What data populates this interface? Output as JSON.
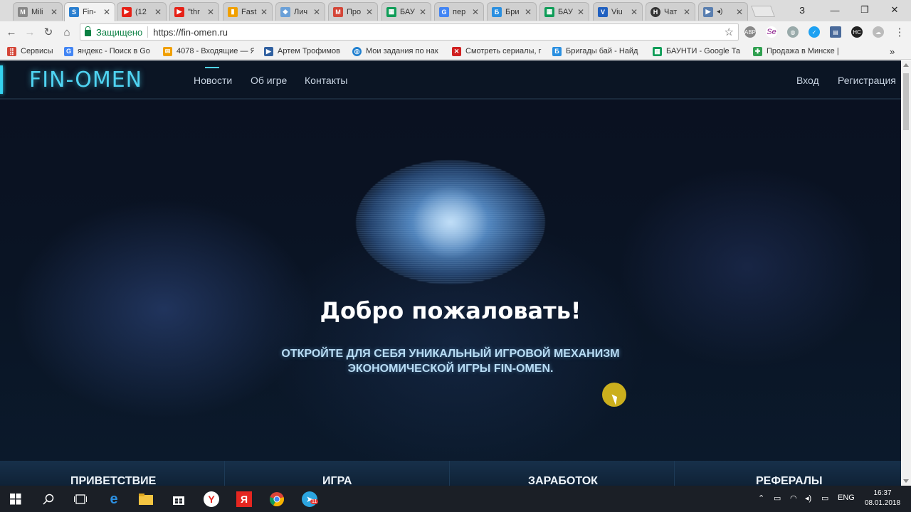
{
  "browser": {
    "tabs": [
      {
        "title": "Mili",
        "favicon": "gmail-m",
        "color": "#888888"
      },
      {
        "title": "Fin-",
        "favicon": "fin-omen",
        "color": "#2a7fd0",
        "active": true
      },
      {
        "title": "(12",
        "favicon": "youtube",
        "color": "#e62117"
      },
      {
        "title": "\"thr",
        "favicon": "youtube",
        "color": "#e62117"
      },
      {
        "title": "Fast",
        "favicon": "chart",
        "color": "#f0a000"
      },
      {
        "title": "Лич",
        "favicon": "diamond",
        "color": "#6aa0d8"
      },
      {
        "title": "Про",
        "favicon": "gmail",
        "color": "#d44638"
      },
      {
        "title": "БАУ",
        "favicon": "sheets",
        "color": "#0f9d58"
      },
      {
        "title": "пер",
        "favicon": "google",
        "color": "#4285f4"
      },
      {
        "title": "Бри",
        "favicon": "b",
        "color": "#2a8fe0"
      },
      {
        "title": "БАУ",
        "favicon": "sheets",
        "color": "#0f9d58"
      },
      {
        "title": "Viu",
        "favicon": "shield",
        "color": "#2060c0"
      },
      {
        "title": "Чат",
        "favicon": "hc",
        "color": "#333333"
      },
      {
        "title": "",
        "favicon": "play",
        "color": "#5a7fb0"
      }
    ],
    "window_controls": {
      "user": "З",
      "minimize": "—",
      "maximize": "❐",
      "close": "✕"
    },
    "address": {
      "secure_label": "Защищено",
      "url": "https://fin-omen.ru"
    },
    "bookmarks": [
      {
        "label": "Сервисы",
        "icon": "apps-icon",
        "color": "#d44638"
      },
      {
        "label": "яндекс - Поиск в Go",
        "icon": "google-icon",
        "color": "#4285f4"
      },
      {
        "label": "4078 - Входящие — Я",
        "icon": "mail-icon",
        "color": "#f0a000"
      },
      {
        "label": "Артем Трофимов",
        "icon": "play-icon",
        "color": "#3060a0"
      },
      {
        "label": "Мои задания по нак",
        "icon": "target-icon",
        "color": "#2080d0"
      },
      {
        "label": "Смотреть сериалы, г",
        "icon": "x-icon",
        "color": "#d02020"
      },
      {
        "label": "Бригады бай - Найд",
        "icon": "b-icon",
        "color": "#2a8fe0"
      },
      {
        "label": "БАУНТИ - Google Та",
        "icon": "sheets-icon",
        "color": "#0f9d58"
      },
      {
        "label": "Продажа в Минске |",
        "icon": "cross-icon",
        "color": "#30a050"
      }
    ]
  },
  "site": {
    "logo": "FIN-OMEN",
    "nav": [
      "Новости",
      "Об игре",
      "Контакты"
    ],
    "auth": {
      "login": "Вход",
      "register": "Регистрация"
    },
    "hero": {
      "title": "Добро пожаловать!",
      "subtitle_line1": "ОТКРОЙТЕ ДЛЯ СЕБЯ УНИКАЛЬНЫЙ ИГРОВОЙ МЕХАНИЗМ",
      "subtitle_line2": "ЭКОНОМИЧЕСКОЙ ИГРЫ FIN-OMEN."
    },
    "sections": [
      "ПРИВЕТСТВИЕ",
      "ИГРА",
      "ЗАРАБОТОК",
      "РЕФЕРАЛЫ"
    ]
  },
  "taskbar": {
    "language": "ENG",
    "time": "16:37",
    "date": "08.01.2018",
    "telegram_badge": "11"
  }
}
